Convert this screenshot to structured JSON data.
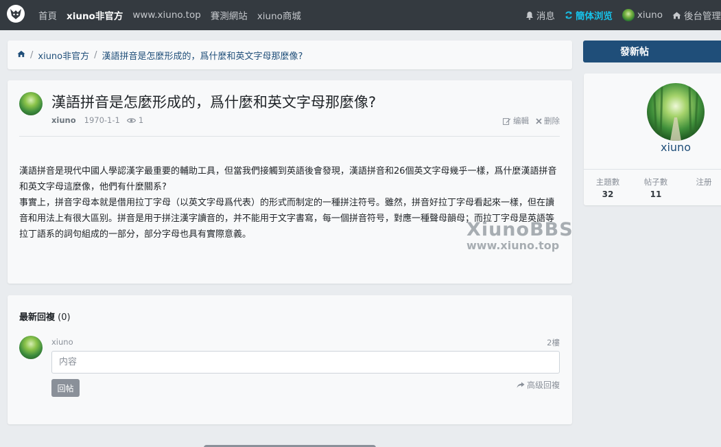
{
  "nav": {
    "items": [
      {
        "label": "首頁",
        "active": false
      },
      {
        "label": "xiuno非官方",
        "active": true
      },
      {
        "label": "www.xiuno.top",
        "active": false
      },
      {
        "label": "賽測網站",
        "active": false
      },
      {
        "label": "xiuno商城",
        "active": false
      }
    ],
    "messages_label": "消息",
    "lang_label": "簡体浏览",
    "user_label": "xiuno",
    "admin_label": "後台管理"
  },
  "breadcrumb": {
    "items": [
      "xiuno非官方",
      "漢語拼音是怎麼形成的，爲什麼和英文字母那麼像?"
    ]
  },
  "thread": {
    "title": "漢語拼音是怎麼形成的，爲什麼和英文字母那麼像?",
    "author": "xiuno",
    "date": "1970-1-1",
    "views": "1",
    "edit_label": "编輯",
    "delete_label": "删除",
    "paragraphs": [
      "漢語拼音是現代中國人學認漢字最重要的輔助工具，但當我們接觸到英語後會發現，漢語拼音和26個英文字母幾乎一樣，爲什麼漢語拼音和英文字母這麼像，他們有什麼關系?",
      "事實上，拼音字母本就是借用拉丁字母（以英文字母爲代表）的形式而制定的一種拼注符号。雖然，拼音好拉丁字母看起來一樣，但在讀音和用法上有很大區别。拼音是用于拼注漢字讀音的，并不能用于文字書寫，每一個拼音符号，對應一種聲母韻母；而拉丁字母是英語等拉丁語系的詞句組成的一部分，部分字母也具有實際意義。"
    ],
    "watermark_line1": "XiunoBBS",
    "watermark_line2": "www.xiuno.top"
  },
  "reply": {
    "heading": "最新回複",
    "count": "(0)",
    "username": "xiuno",
    "floor": "2樓",
    "placeholder": "内容",
    "submit_label": "回帖",
    "advanced_label": "高级回複"
  },
  "sidebar": {
    "post_button": "發新帖",
    "username": "xiuno",
    "stats": [
      {
        "label": "主題數",
        "value": "32"
      },
      {
        "label": "帖子數",
        "value": "11"
      },
      {
        "label": "注册",
        "value": ""
      }
    ]
  },
  "colors": {
    "topbar": "#343a40",
    "accent": "#1f4e79",
    "lang_cyan": "#17c1e8",
    "muted": "#8a9099"
  }
}
